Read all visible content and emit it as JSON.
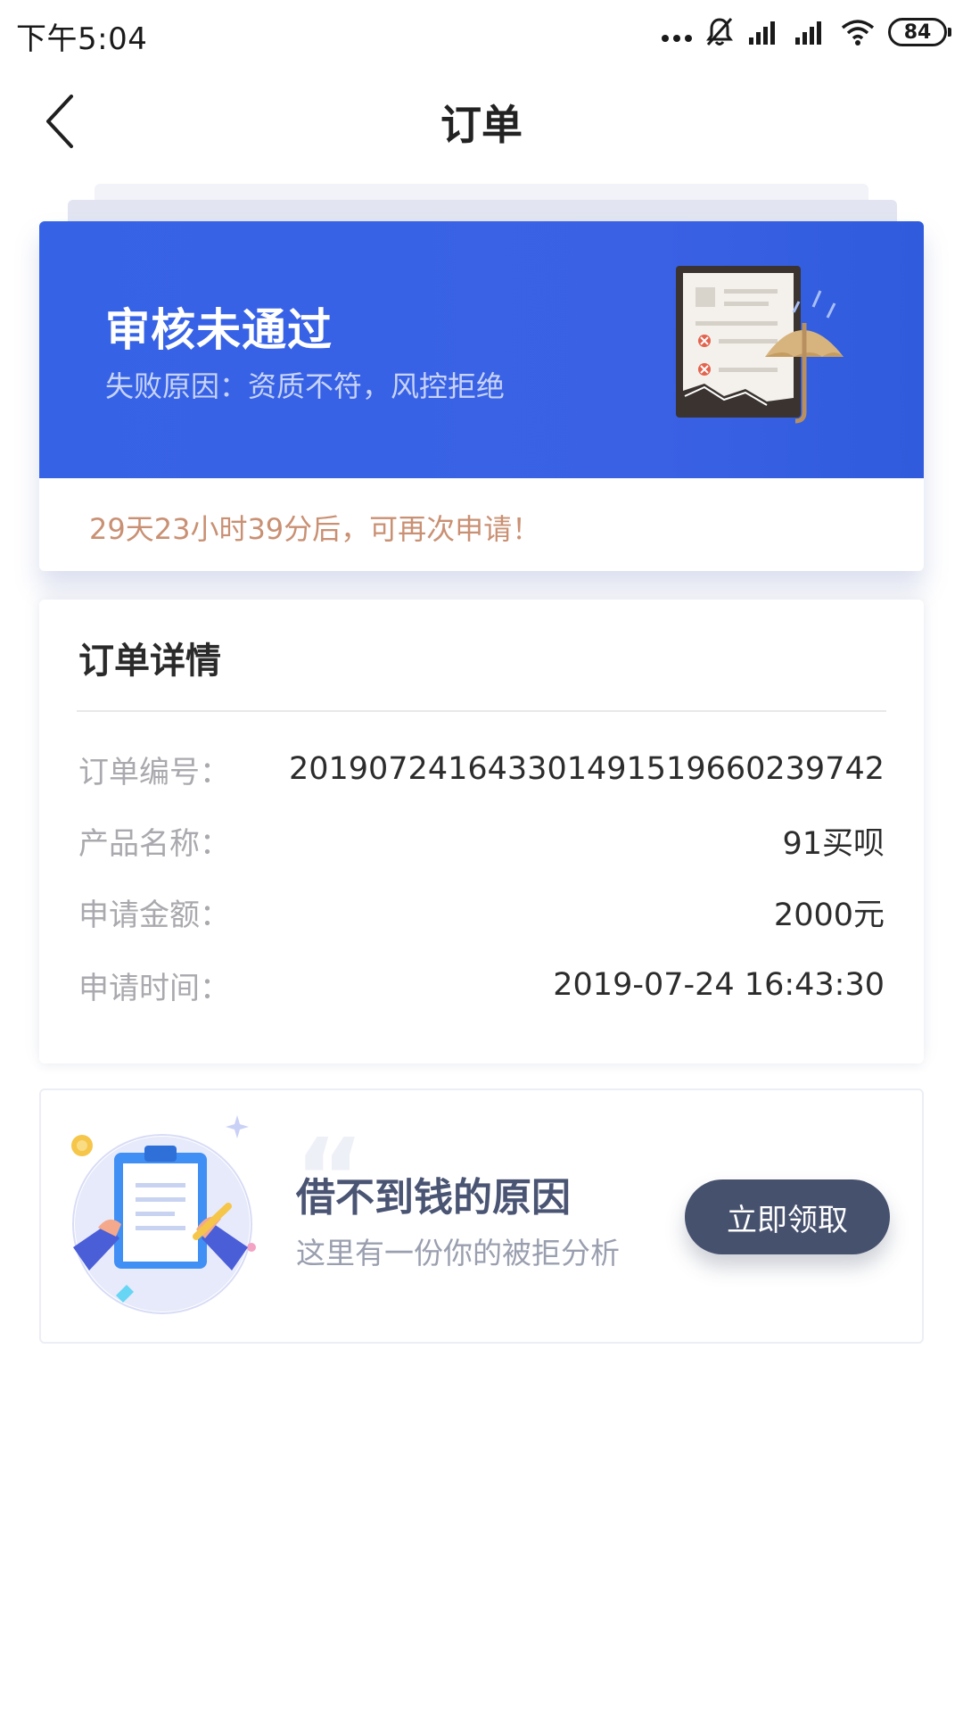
{
  "status_bar": {
    "time": "下午5:04",
    "battery": "84",
    "icons": [
      "more-dots-icon",
      "mute-icon",
      "signal-icon",
      "signal-icon",
      "wifi-icon",
      "battery-icon"
    ]
  },
  "nav": {
    "title": "订单",
    "back_icon": "chevron-left-icon"
  },
  "status_card": {
    "title": "审核未通过",
    "reason": "失败原因：资质不符，风控拒绝",
    "countdown": "29天23小时39分后，可再次申请！",
    "colors": {
      "banner": "#3663e6",
      "countdown": "#c99073"
    }
  },
  "order_detail": {
    "heading": "订单详情",
    "rows": [
      {
        "label": "订单编号：",
        "value": "2019072416433014915196602397​42"
      },
      {
        "label": "产品名称：",
        "value": "91买呗"
      },
      {
        "label": "申请金额：",
        "value": "2000元"
      },
      {
        "label": "申请时间：",
        "value": "2019-07-24 16:43:30"
      }
    ]
  },
  "promo": {
    "title": "借不到钱的原因",
    "subtitle": "这里有一份你的被拒分析",
    "button_label": "立即领取",
    "colors": {
      "button": "#46516e"
    }
  }
}
